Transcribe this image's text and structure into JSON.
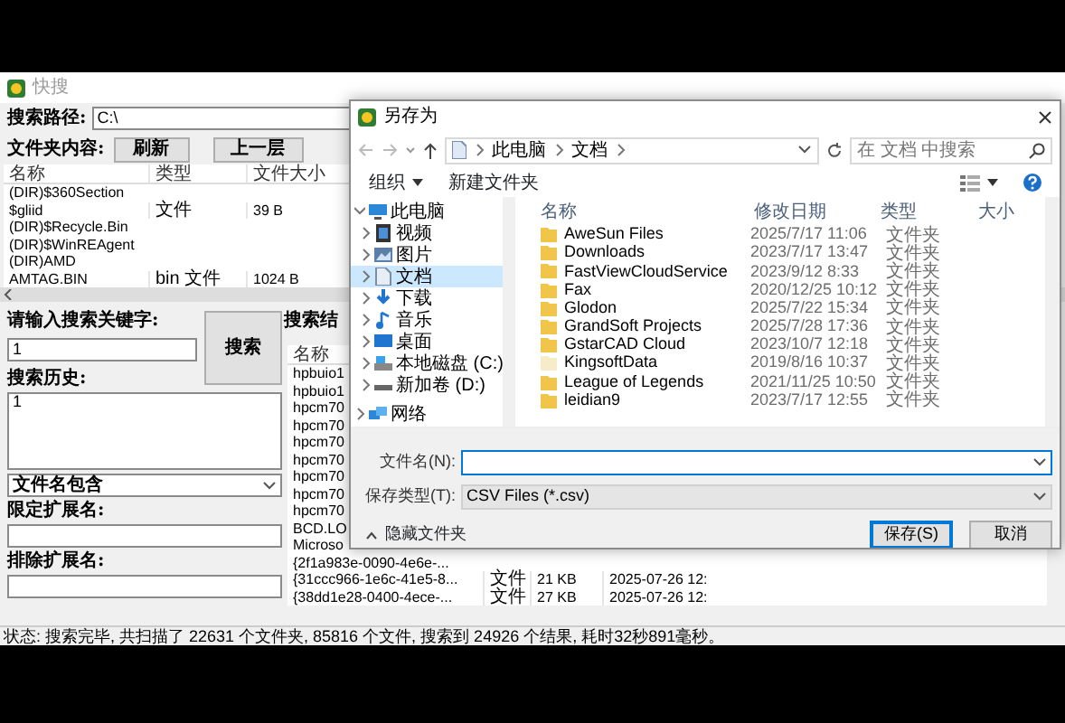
{
  "app": {
    "title": "快搜",
    "path_label": "搜索路径:",
    "path": "C:\\",
    "folder_label": "文件夹内容:",
    "buttons": [
      "刷新",
      "上一层"
    ],
    "folder_table": {
      "columns": [
        "名称",
        "类型",
        "文件大小"
      ],
      "rows": [
        {
          "name": "(DIR)$360Section"
        },
        {
          "name": "$gliid",
          "type": "文件",
          "size": "39 B"
        },
        {
          "name": "(DIR)$Recycle.Bin"
        },
        {
          "name": "(DIR)$WinREAgent"
        },
        {
          "name": "(DIR)AMD"
        },
        {
          "name": "AMTAG.BIN",
          "type": "bin 文件",
          "size": "1024 B"
        }
      ]
    },
    "keyword_label": "请输入搜索关键字:",
    "keyword": "1",
    "search_button": "搜索",
    "history_label": "搜索历史:",
    "history": "1",
    "match_mode": "文件名包含",
    "include_ext_label": "限定扩展名:",
    "exclude_ext_label": "排除扩展名:",
    "results_label": "搜索结",
    "results_table": {
      "columns": [
        "名称"
      ],
      "rows": [
        {
          "name": "hpbuio1"
        },
        {
          "name": "hpbuio1"
        },
        {
          "name": "hpcm70"
        },
        {
          "name": "hpcm70"
        },
        {
          "name": "hpcm70"
        },
        {
          "name": "hpcm70"
        },
        {
          "name": "hpcm70"
        },
        {
          "name": "hpcm70"
        },
        {
          "name": "hpcm70"
        },
        {
          "name": "BCD.LO"
        },
        {
          "name": "Microso"
        },
        {
          "name": "{2f1a983e-0090-4e6e-..."
        },
        {
          "name": "{31ccc966-1e6c-41e5-8...",
          "type": "文件",
          "size": "21 KB",
          "date": "2025-07-26 12:"
        },
        {
          "name": "{38dd1e28-0400-4ece-...",
          "type": "文件",
          "size": "27 KB",
          "date": "2025-07-26 12:"
        }
      ]
    },
    "status": "状态: 搜索完毕, 共扫描了 22631 个文件夹, 85816 个文件, 搜索到 24926 个结果, 耗时32秒891毫秒。"
  },
  "dialog": {
    "title": "另存为",
    "breadcrumb": [
      "此电脑",
      "文档"
    ],
    "search_placeholder": "在 文档 中搜索",
    "toolbar": [
      "组织",
      "新建文件夹"
    ],
    "nav": [
      {
        "label": "此电脑",
        "expanded": true,
        "selected": false,
        "children": [
          {
            "label": "视频",
            "expanded": false,
            "selected": false
          },
          {
            "label": "图片",
            "expanded": false,
            "selected": false
          },
          {
            "label": "文档",
            "expanded": false,
            "selected": true
          },
          {
            "label": "下载",
            "expanded": false,
            "selected": false
          },
          {
            "label": "音乐",
            "expanded": false,
            "selected": false
          },
          {
            "label": "桌面",
            "expanded": false,
            "selected": false
          },
          {
            "label": "本地磁盘 (C:)",
            "expanded": false,
            "selected": false
          },
          {
            "label": "新加卷 (D:)",
            "expanded": false,
            "selected": false
          }
        ]
      },
      {
        "label": "网络",
        "expanded": false,
        "selected": false
      }
    ],
    "columns": [
      "名称",
      "修改日期",
      "类型",
      "大小"
    ],
    "files": [
      {
        "name": "AweSun Files",
        "date": "2025/7/17 11:06",
        "type": "文件夹",
        "hidden": false
      },
      {
        "name": "Downloads",
        "date": "2023/7/17 13:47",
        "type": "文件夹",
        "hidden": false
      },
      {
        "name": "FastViewCloudService",
        "date": "2023/9/12 8:33",
        "type": "文件夹",
        "hidden": false
      },
      {
        "name": "Fax",
        "date": "2020/12/25 10:12",
        "type": "文件夹",
        "hidden": false
      },
      {
        "name": "Glodon",
        "date": "2025/7/22 15:34",
        "type": "文件夹",
        "hidden": false
      },
      {
        "name": "GrandSoft Projects",
        "date": "2025/7/28 17:36",
        "type": "文件夹",
        "hidden": false
      },
      {
        "name": "GstarCAD Cloud",
        "date": "2023/10/7 12:18",
        "type": "文件夹",
        "hidden": false
      },
      {
        "name": "KingsoftData",
        "date": "2019/8/16 10:37",
        "type": "文件夹",
        "hidden": true
      },
      {
        "name": "League of Legends",
        "date": "2021/11/25 10:50",
        "type": "文件夹",
        "hidden": false
      },
      {
        "name": "leidian9",
        "date": "2023/7/17 12:55",
        "type": "文件夹",
        "hidden": false
      }
    ],
    "filename_label": "文件名(N):",
    "filetype_label": "保存类型(T):",
    "filetype": "CSV Files (*.csv)",
    "hide_folders": "隐藏文件夹",
    "buttons": [
      {
        "label": "保存(S)",
        "default": true
      },
      {
        "label": "取消",
        "default": false
      }
    ]
  }
}
